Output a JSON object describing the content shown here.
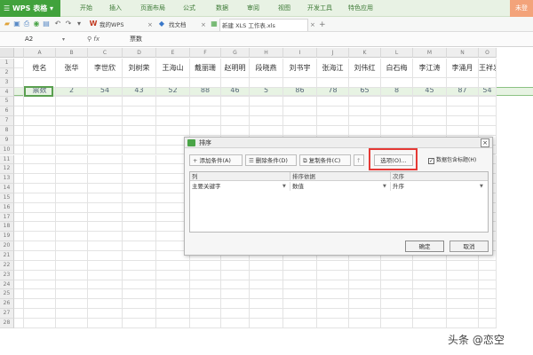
{
  "titlebar": {
    "app_name": "WPS 表格",
    "menus": [
      "开始",
      "插入",
      "页面布局",
      "公式",
      "数据",
      "审阅",
      "视图",
      "开发工具",
      "特色应用"
    ],
    "window_button": "未登"
  },
  "tabs": [
    {
      "label": "我的WPS"
    },
    {
      "label": "找文档"
    },
    {
      "label": "新建 XLS 工作表.xls"
    }
  ],
  "formula_bar": {
    "name_box": "A2",
    "fx": "fx",
    "value": "票数"
  },
  "grid": {
    "columns": [
      "A",
      "B",
      "C",
      "D",
      "E",
      "F",
      "G",
      "H",
      "I",
      "J",
      "K",
      "L",
      "M",
      "N",
      "O"
    ],
    "rows": [
      "1",
      "2",
      "3",
      "4",
      "5",
      "6",
      "7",
      "8",
      "9",
      "10",
      "11",
      "12",
      "13",
      "14",
      "15",
      "16",
      "17",
      "18",
      "19",
      "20",
      "21",
      "22",
      "23",
      "24",
      "25",
      "26",
      "27",
      "28"
    ],
    "row1": [
      "姓名",
      "张华",
      "李世欣",
      "刘树荣",
      "王海山",
      "戴丽珊",
      "赵明明",
      "段晓燕",
      "刘书宇",
      "张海江",
      "刘伟红",
      "白石梅",
      "李江涛",
      "李涌月",
      "王祥发",
      "胡"
    ],
    "row2": [
      "票数",
      "2",
      "54",
      "43",
      "52",
      "88",
      "46",
      "5",
      "86",
      "78",
      "65",
      "8",
      "45",
      "87",
      "54"
    ]
  },
  "dialog": {
    "title": "排序",
    "buttons": {
      "add": "添加条件(A)",
      "delete": "删除条件(D)",
      "copy": "复制条件(C)",
      "options": "选项(O)..."
    },
    "has_header_checkbox": "数据包含标题(H)",
    "headers": {
      "column": "列",
      "sort_on": "排序依据",
      "order": "次序"
    },
    "row": {
      "key": "主要关键字",
      "sort_on": "数值",
      "order": "升序"
    },
    "ok": "确定",
    "cancel": "取消"
  },
  "watermark": "头条 @恋空",
  "colors": {
    "wps_green": "#41a23c",
    "highlight_red": "#e53935"
  }
}
